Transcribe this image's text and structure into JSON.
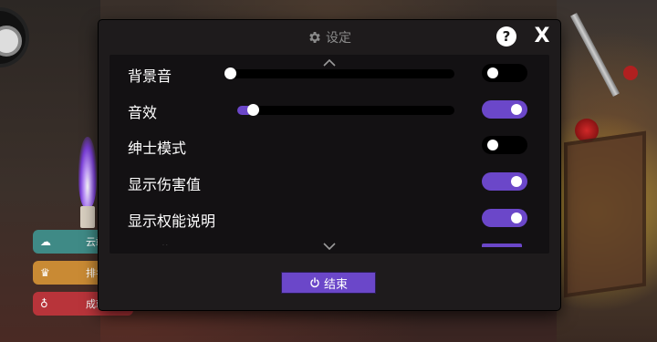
{
  "dialog": {
    "title": "设定",
    "help_label": "?",
    "close_label": "X",
    "end_button_label": "结束"
  },
  "settings": [
    {
      "label": "背景音",
      "type": "slider",
      "value": 0.0,
      "enabled": false
    },
    {
      "label": "音效",
      "type": "slider",
      "value": 0.07,
      "enabled": true
    },
    {
      "label": "绅士模式",
      "type": "toggle",
      "enabled": false
    },
    {
      "label": "显示伤害值",
      "type": "toggle",
      "enabled": true
    },
    {
      "label": "显示权能说明",
      "type": "toggle",
      "enabled": true
    }
  ],
  "side_menu": {
    "cloud_label": "云端",
    "rank_label": "排名",
    "achievement_label": "成就"
  },
  "colors": {
    "accent": "#6b47c9",
    "dialog_bg": "#1e1b1c",
    "panel_bg": "#131113"
  },
  "icons": {
    "title": "gear-icon",
    "end_button": "power-icon",
    "scroll_up": "chevron-up-icon",
    "scroll_down": "chevron-down-icon"
  }
}
